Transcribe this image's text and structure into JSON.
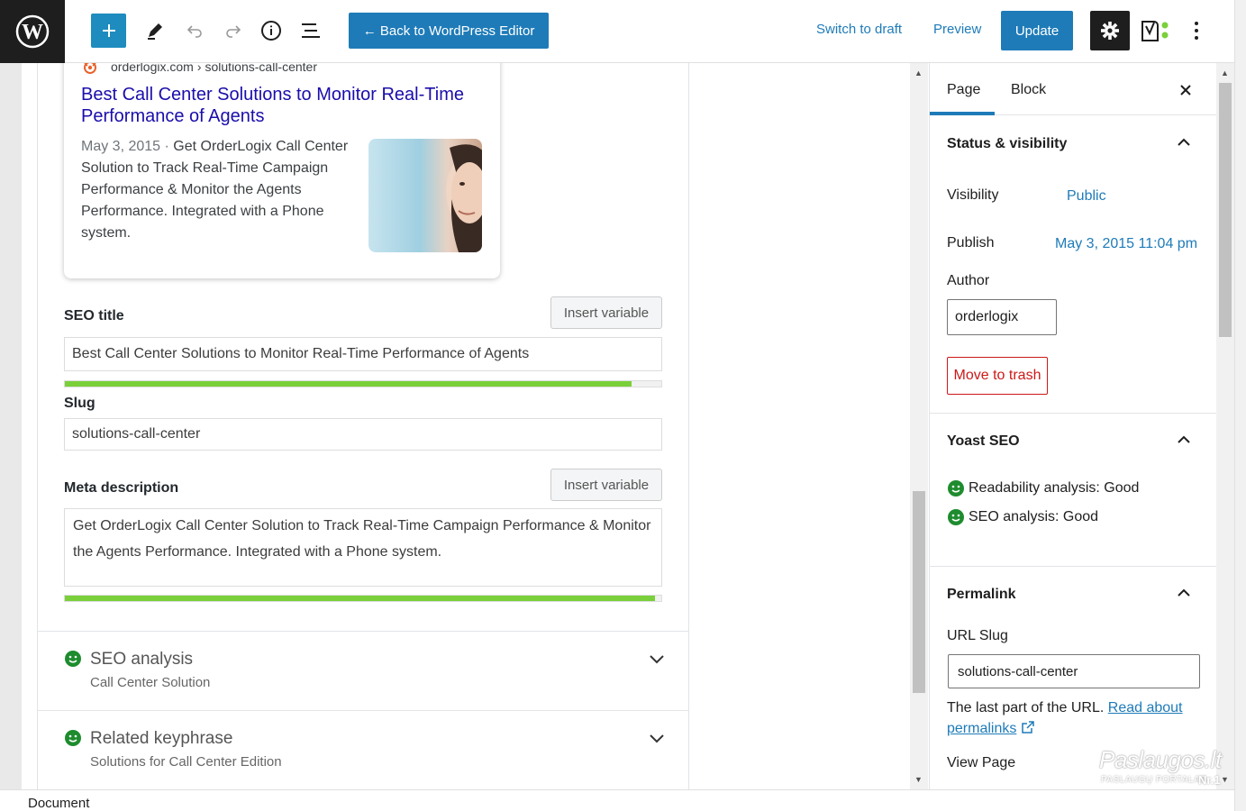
{
  "toolbar": {
    "back_label": "← Back to WordPress Editor",
    "switch_draft": "Switch to draft",
    "preview": "Preview",
    "update": "Update",
    "icons": [
      "wordpress-logo",
      "plus-icon",
      "pencil-icon",
      "undo-icon",
      "redo-icon",
      "info-icon",
      "list-view-icon",
      "settings-gear-icon",
      "yoast-icon",
      "more-vertical-icon"
    ],
    "accent_color": "#1e7bb8"
  },
  "snippet": {
    "domain": "orderlogix.com",
    "separator": "›",
    "path": "solutions-call-center",
    "title": "Best Call Center Solutions to Monitor Real-Time Performance of Agents",
    "date": "May 3, 2015",
    "date_sep": " · ",
    "description": "Get OrderLogix Call Center Solution to Track Real-Time Campaign Performance & Monitor the Agents Performance. Integrated with a Phone system."
  },
  "seo_form": {
    "seo_title_label": "SEO title",
    "insert_variable": "Insert variable",
    "seo_title_value": "Best Call Center Solutions to Monitor Real-Time Performance of Agents",
    "seo_title_progress": 0.95,
    "slug_label": "Slug",
    "slug_value": "solutions-call-center",
    "meta_label": "Meta description",
    "meta_value": "Get OrderLogix Call Center Solution to Track Real-Time Campaign Performance & Monitor the Agents Performance. Integrated with a Phone system.",
    "meta_progress": 0.99,
    "progress_color": "#7ad03a"
  },
  "sections": [
    {
      "title": "SEO analysis",
      "subtitle": "Call Center Solution"
    },
    {
      "title": "Related keyphrase",
      "subtitle": "Solutions for Call Center Edition"
    }
  ],
  "sidebar": {
    "tab_page": "Page",
    "tab_block": "Block",
    "status_heading": "Status & visibility",
    "visibility_label": "Visibility",
    "visibility_value": "Public",
    "publish_label": "Publish",
    "publish_value": "May 3, 2015 11:04 pm",
    "author_label": "Author",
    "author_value": "orderlogix",
    "trash": "Move to trash",
    "yoast_heading": "Yoast SEO",
    "readability": "Readability analysis: Good",
    "seo_analysis": "SEO analysis: Good",
    "permalink_heading": "Permalink",
    "url_slug_label": "URL Slug",
    "url_slug_value": "solutions-call-center",
    "help_text": "The last part of the URL.",
    "help_link": "Read about permalinks",
    "view_page": "View Page",
    "good_color": "#1e8c2e"
  },
  "footer": {
    "breadcrumb": "Document"
  },
  "watermark": {
    "main": "Paslaugos.lt",
    "sub": "PASLAUGŲ PORTALAS",
    "nr": "Nr.1"
  }
}
